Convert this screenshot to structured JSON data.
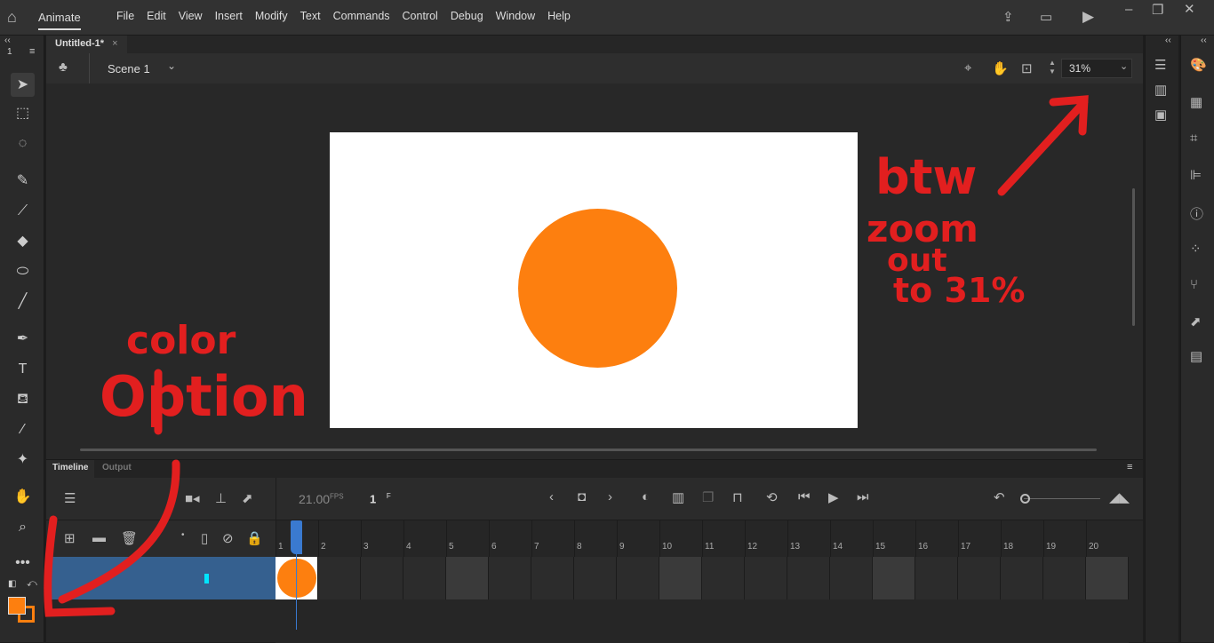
{
  "app": {
    "name": "Animate",
    "menus": [
      "File",
      "Edit",
      "View",
      "Insert",
      "Modify",
      "Text",
      "Commands",
      "Control",
      "Debug",
      "Window",
      "Help"
    ]
  },
  "document": {
    "tab": "Untitled-1*",
    "scene": "Scene 1",
    "zoom": "31%"
  },
  "toolbar_panel": {
    "label": "1"
  },
  "stage": {
    "background": "#ffffff",
    "shape_color": "#fd7f0f"
  },
  "timeline": {
    "tabs": [
      "Timeline",
      "Output"
    ],
    "fps": "21.00",
    "fps_unit": "FPS",
    "current_frame": "1",
    "frame_unit": "F",
    "frame_numbers": [
      "1",
      "2",
      "3",
      "4",
      "5",
      "6",
      "7",
      "8",
      "9",
      "10",
      "11",
      "12",
      "13",
      "14",
      "15",
      "16",
      "17",
      "18",
      "19",
      "20"
    ]
  },
  "colors": {
    "fill": "#fd7f0f",
    "stroke": "#fd7f0f",
    "annotation": "#e21f1f"
  },
  "annotations": {
    "right": [
      "btw",
      "zoom",
      "out",
      "to 31%"
    ],
    "left": [
      "color",
      "Option"
    ]
  }
}
